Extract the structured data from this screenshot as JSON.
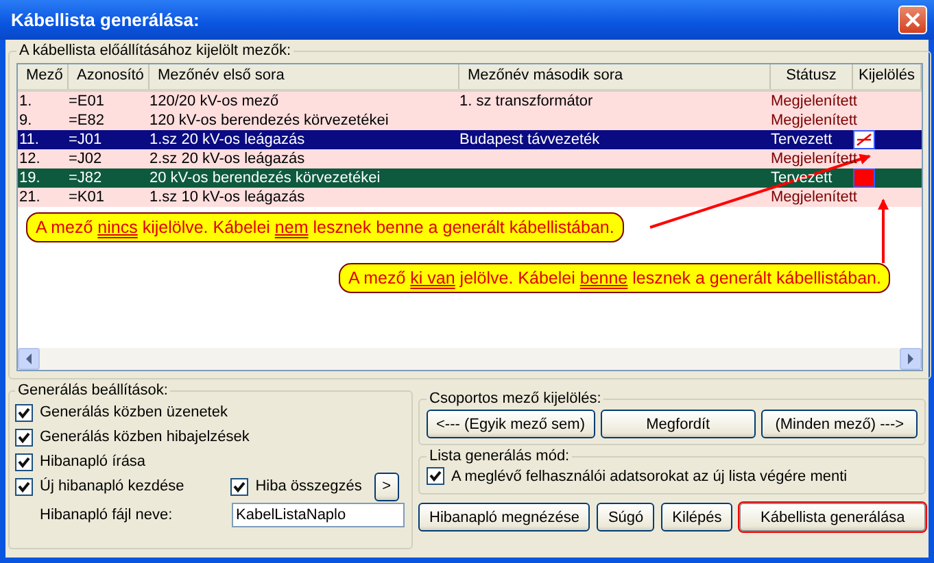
{
  "window": {
    "title": "Kábellista generálása:"
  },
  "fields_group": {
    "title": "A kábellista előállításához kijelölt mezők:",
    "table": {
      "columns": [
        "Mező",
        "Azonosító",
        "Mezőnév első sora",
        "Mezőnév második sora",
        "Státusz",
        "Kijelölés"
      ],
      "rows": [
        {
          "cells": [
            "1.",
            "=E01",
            "120/20 kV-os mező",
            "1. sz transzformátor",
            "Megjelenített"
          ],
          "selected": false
        },
        {
          "cells": [
            "9.",
            "=E82",
            "120 kV-os berendezés körvezetékei",
            "",
            "Megjelenített"
          ],
          "selected": false
        },
        {
          "cells": [
            "11.",
            "=J01",
            "1.sz 20 kV-os leágazás",
            "Budapest távvezeték",
            "Tervezett"
          ],
          "selected": true,
          "color": "#0a0a82",
          "marked": false
        },
        {
          "cells": [
            "12.",
            "=J02",
            "2.sz 20 kV-os leágazás",
            "",
            "Megjelenített"
          ],
          "selected": false
        },
        {
          "cells": [
            "19.",
            "=J82",
            "20 kV-os berendezés körvezetékei",
            "",
            "Tervezett"
          ],
          "selected": true,
          "color": "#0e5a3e",
          "marked": true
        },
        {
          "cells": [
            "21.",
            "=K01",
            "1.sz 10 kV-os leágazás",
            "",
            "Megjelenített"
          ],
          "selected": false
        }
      ]
    }
  },
  "callouts": [
    {
      "parts": [
        {
          "text": "A mező "
        },
        {
          "text": "nincs",
          "underline": true
        },
        {
          "text": " kijelölve. Kábelei "
        },
        {
          "text": "nem",
          "underline": true
        },
        {
          "text": " lesznek benne a generált kábellistában."
        }
      ]
    },
    {
      "parts": [
        {
          "text": "A mező "
        },
        {
          "text": "ki van",
          "underline": true
        },
        {
          "text": " jelölve. Kábelei "
        },
        {
          "text": "benne",
          "underline": true
        },
        {
          "text": " lesznek a generált kábellistában."
        }
      ]
    }
  ],
  "settings": {
    "title": "Generálás beállítások:",
    "options": [
      {
        "label": "Generálás közben üzenetek",
        "checked": true
      },
      {
        "label": "Generálás közben hibajelzések",
        "checked": true
      },
      {
        "label": "Hibanapló írása",
        "checked": true
      },
      {
        "label": "Új hibanapló kezdése",
        "checked": true
      }
    ],
    "summary": {
      "label": "Hiba összegzés",
      "checked": true
    },
    "more_button": ">",
    "log_file": {
      "label": "Hibanapló fájl neve:",
      "value": "KabelListaNaplo"
    }
  },
  "group_select": {
    "title": "Csoportos mező kijelölés:",
    "buttons": [
      "<--- (Egyik mező sem)",
      "Megfordít",
      "(Minden mező) --->"
    ]
  },
  "list_mode": {
    "title": "Lista generálás mód:",
    "option": {
      "label": "A meglévő felhasználói adatsorokat az új lista végére menti",
      "checked": true
    }
  },
  "buttons": [
    {
      "label": "Hibanapló megnézése",
      "default": false
    },
    {
      "label": "Súgó",
      "default": false
    },
    {
      "label": "Kilépés",
      "default": false
    },
    {
      "label": "Kábellista generálása",
      "default": true
    }
  ]
}
